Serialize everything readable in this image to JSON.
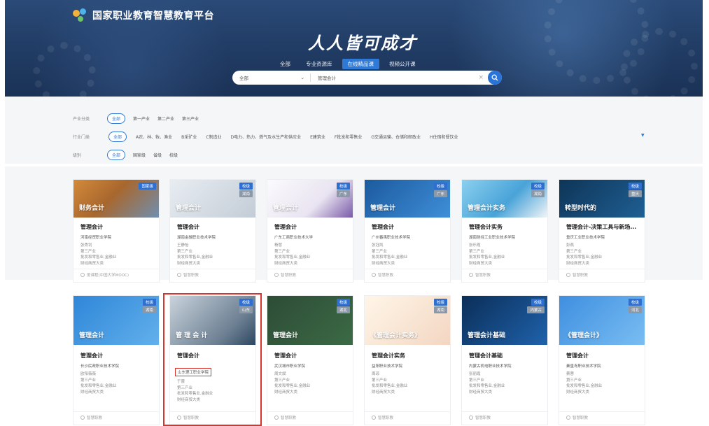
{
  "header": {
    "platform_title": "国家职业教育智慧教育平台",
    "slogan": "人人皆可成才",
    "tabs": [
      "全部",
      "专业资源库",
      "在线精品课",
      "视频公开课"
    ],
    "active_tab": "在线精品课",
    "search": {
      "category": "全部",
      "query": "管理会计"
    }
  },
  "filters": {
    "industry_category": {
      "label": "产业分类",
      "options": [
        "全部",
        "第一产业",
        "第二产业",
        "第三产业"
      ]
    },
    "industry_sector": {
      "label": "行业门类",
      "options": [
        "全部",
        "A农、林、牧、渔业",
        "B采矿业",
        "C制造业",
        "D电力、热力、燃气及水生产和供应业",
        "E建筑业",
        "F批发和零售业",
        "G交通运输、仓储和邮政业",
        "H住宿和餐饮业"
      ]
    },
    "level": {
      "label": "级别",
      "options": [
        "全部",
        "国家级",
        "省级",
        "校级"
      ]
    }
  },
  "row1": [
    {
      "title": "管理会计",
      "school": "河南经贸职业学院",
      "teacher": "张秀钊",
      "industry": "第三产业",
      "sector": "批发和零售业,金融业",
      "category": "财经商贸大类",
      "source": "爱课程(中国大学MOOC)",
      "badge": "国家级",
      "badge_sub": "",
      "thumb_text": "财务会计"
    },
    {
      "title": "管理会计",
      "school": "湖南金融职业技术学院",
      "teacher": "王静怡",
      "industry": "第三产业",
      "sector": "批发和零售业,金融业",
      "category": "财经商贸大类",
      "source": "智慧职教",
      "badge": "校级",
      "badge_sub": "湖南",
      "thumb_text": "管理会计"
    },
    {
      "title": "管理会计",
      "school": "广东工商职业技术大学",
      "teacher": "杨慧",
      "industry": "第三产业",
      "sector": "批发和零售业,金融业",
      "category": "财经商贸大类",
      "source": "智慧职教",
      "badge": "校级",
      "badge_sub": "广东",
      "thumb_text": "管理会计"
    },
    {
      "title": "管理会计",
      "school": "广州番禺职业技术学院",
      "teacher": "张钰凯",
      "industry": "第三产业",
      "sector": "批发和零售业,金融业",
      "category": "财经商贸大类",
      "source": "智慧职教",
      "badge": "校级",
      "badge_sub": "广东",
      "thumb_text": "管理会计"
    },
    {
      "title": "管理会计实务",
      "school": "湖南财经工业职业技术学院",
      "teacher": "张乐霞",
      "industry": "第三产业",
      "sector": "批发和零售业,金融业",
      "category": "财经商贸大类",
      "source": "智慧职教",
      "badge": "校级",
      "badge_sub": "湖南",
      "thumb_text": "管理会计实务"
    },
    {
      "title": "管理会计-决策工具与新场...",
      "school": "重庆工业职业技术学院",
      "teacher": "彭燕",
      "industry": "第三产业",
      "sector": "批发和零售业,金融业",
      "category": "财经商贸大类",
      "source": "智慧职教",
      "badge": "校级",
      "badge_sub": "重庆",
      "thumb_text": "转型时代的"
    }
  ],
  "row2": [
    {
      "title": "管理会计",
      "school": "长沙民政职业技术学院",
      "teacher": "欧阳薇薇",
      "industry": "第三产业",
      "sector": "批发和零售业,金融业",
      "category": "财经商贸大类",
      "source": "智慧职教",
      "badge": "校级",
      "badge_sub": "湖南",
      "thumb_text": "管理会计"
    },
    {
      "title": "管理会计",
      "school": "山东理工职业学院",
      "teacher": "于蕾",
      "industry": "第三产业",
      "sector": "批发和零售业,金融业",
      "category": "财经商贸大类",
      "source": "智慧职教",
      "badge": "校级",
      "badge_sub": "山东",
      "thumb_text": "管 理 会 计"
    },
    {
      "title": "管理会计",
      "school": "武汉城市职业学院",
      "teacher": "周文斌",
      "industry": "第三产业",
      "sector": "批发和零售业,金融业",
      "category": "财经商贸大类",
      "source": "智慧职教",
      "badge": "校级",
      "badge_sub": "湖北",
      "thumb_text": "管理会计"
    },
    {
      "title": "管理会计实务",
      "school": "益阳职业技术学院",
      "teacher": "周琼",
      "industry": "第三产业",
      "sector": "批发和零售业,金融业",
      "category": "财经商贸大类",
      "source": "智慧职教",
      "badge": "校级",
      "badge_sub": "湖南",
      "thumb_text": "《管理会计实务》"
    },
    {
      "title": "管理会计基础",
      "school": "内蒙古机电职业技术学院",
      "teacher": "张丽霞",
      "industry": "第三产业",
      "sector": "批发和零售业,金融业",
      "category": "财经商贸大类",
      "source": "智慧职教",
      "badge": "校级",
      "badge_sub": "内蒙古",
      "thumb_text": "管理会计基础"
    },
    {
      "title": "管理会计",
      "school": "秦皇岛职业技术学院",
      "teacher": "蔡蓉",
      "industry": "第三产业",
      "sector": "批发和零售业,金融业",
      "category": "财经商贸大类",
      "source": "智慧职教",
      "badge": "校级",
      "badge_sub": "河北",
      "thumb_text": "《管理会计》"
    }
  ],
  "colors": {
    "accent": "#2e7ad6",
    "highlight": "#d9342b",
    "banner": "#203b63"
  }
}
